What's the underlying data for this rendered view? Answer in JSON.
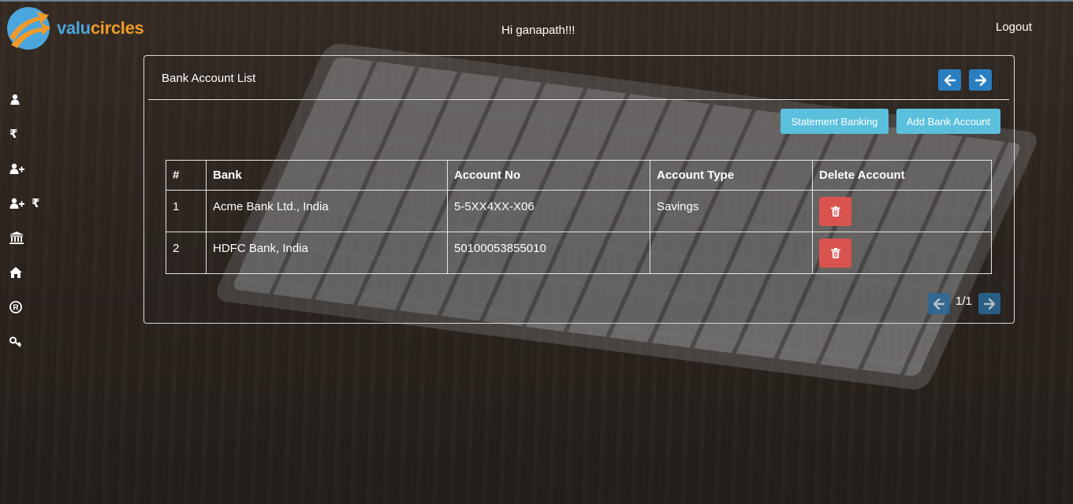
{
  "header": {
    "logo_text_part1": "valu",
    "logo_text_part2": "circles",
    "greeting": "Hi ganapath!!!",
    "logout_label": "Logout"
  },
  "sidebar": {
    "items": [
      {
        "name": "profile",
        "icon": "user-icon"
      },
      {
        "name": "income",
        "icon": "rupee-icon",
        "glyph": "₹"
      },
      {
        "name": "add-member",
        "icon": "user-plus-icon"
      },
      {
        "name": "member-income",
        "icon": "user-plus-rupee-icon",
        "glyph": "₹"
      },
      {
        "name": "bank",
        "icon": "bank-icon"
      },
      {
        "name": "home",
        "icon": "home-icon"
      },
      {
        "name": "registered",
        "icon": "registered-icon"
      },
      {
        "name": "password",
        "icon": "key-icon"
      }
    ]
  },
  "panel": {
    "title": "Bank Account List",
    "prev_icon": "arrow-left-icon",
    "next_icon": "arrow-right-icon",
    "statement_banking_label": "Statement Banking",
    "add_bank_account_label": "Add Bank Account"
  },
  "table": {
    "headers": [
      "#",
      "Bank",
      "Account No",
      "Account Type",
      "Delete Account"
    ],
    "rows": [
      {
        "num": "1",
        "bank": "Acme Bank Ltd., India",
        "account_no": "5-5XX4XX-X06",
        "account_type": "Savings"
      },
      {
        "num": "2",
        "bank": "HDFC Bank, India",
        "account_no": "50100053855010",
        "account_type": ""
      }
    ],
    "delete_icon": "trash-icon"
  },
  "pagination": {
    "text": "1/1"
  },
  "colors": {
    "primary_nav": "#2a7fc3",
    "info_button": "#5bc0de",
    "danger_button": "#d9534f",
    "logo_blue": "#4aa6dd",
    "logo_orange": "#f09a2a"
  }
}
